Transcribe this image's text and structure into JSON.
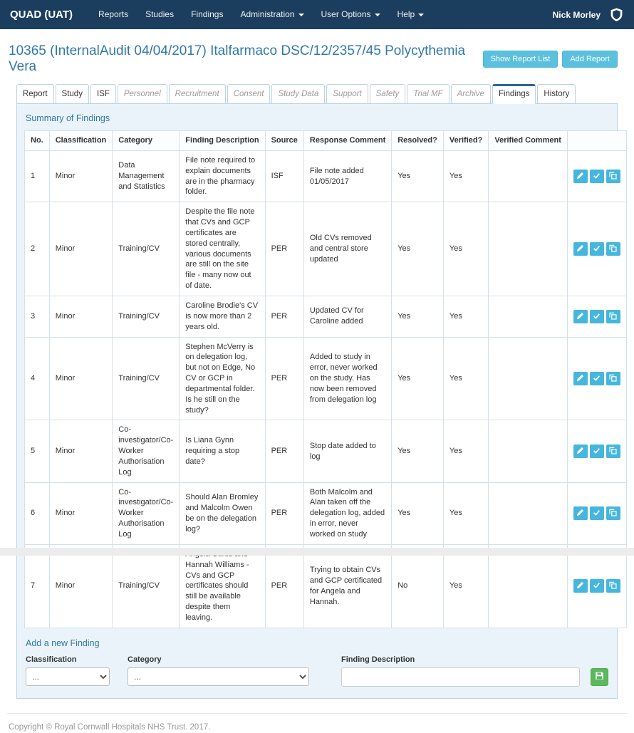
{
  "navbar": {
    "brand": "QUAD (UAT)",
    "items": [
      {
        "label": "Reports",
        "dropdown": false
      },
      {
        "label": "Studies",
        "dropdown": false
      },
      {
        "label": "Findings",
        "dropdown": false
      },
      {
        "label": "Administration",
        "dropdown": true
      },
      {
        "label": "User Options",
        "dropdown": true
      },
      {
        "label": "Help",
        "dropdown": true
      }
    ],
    "user": "Nick Morley",
    "logo_icon": "trust-logo-icon"
  },
  "header": {
    "title": "10365 (InternalAudit 04/04/2017) Italfarmaco DSC/12/2357/45 Polycythemia Vera",
    "show_report_list_label": "Show Report List",
    "add_report_label": "Add Report"
  },
  "tabs": [
    {
      "label": "Report",
      "state": "enabled"
    },
    {
      "label": "Study",
      "state": "enabled"
    },
    {
      "label": "ISF",
      "state": "enabled"
    },
    {
      "label": "Personnel",
      "state": "disabled"
    },
    {
      "label": "Recruitment",
      "state": "disabled"
    },
    {
      "label": "Consent",
      "state": "disabled"
    },
    {
      "label": "Study Data",
      "state": "disabled"
    },
    {
      "label": "Support",
      "state": "disabled"
    },
    {
      "label": "Safety",
      "state": "disabled"
    },
    {
      "label": "Trial MF",
      "state": "disabled"
    },
    {
      "label": "Archive",
      "state": "disabled"
    },
    {
      "label": "Findings",
      "state": "active"
    },
    {
      "label": "History",
      "state": "enabled"
    }
  ],
  "findings": {
    "section_title": "Summary of Findings",
    "columns": [
      "No.",
      "Classification",
      "Category",
      "Finding Description",
      "Source",
      "Response Comment",
      "Resolved?",
      "Verified?",
      "Verified Comment",
      ""
    ],
    "row_actions": [
      {
        "name": "edit",
        "icon": "pencil-icon"
      },
      {
        "name": "verify",
        "icon": "check-icon"
      },
      {
        "name": "copy",
        "icon": "copy-icon"
      }
    ],
    "rows": [
      {
        "no": "1",
        "classification": "Minor",
        "category": "Data Management and Statistics",
        "description": "File note required to explain documents are in the pharmacy folder.",
        "source": "ISF",
        "response": "File note added 01/05/2017",
        "resolved": "Yes",
        "verified": "Yes",
        "verified_comment": ""
      },
      {
        "no": "2",
        "classification": "Minor",
        "category": "Training/CV",
        "description": "Despite the file note that CVs and GCP certificates are stored centrally, various documents are still on the site file - many now out of date.",
        "source": "PER",
        "response": "Old CVs removed and central store updated",
        "resolved": "Yes",
        "verified": "Yes",
        "verified_comment": ""
      },
      {
        "no": "3",
        "classification": "Minor",
        "category": "Training/CV",
        "description": "Caroline Brodie's CV is now more than 2 years old.",
        "source": "PER",
        "response": "Updated CV for Caroline added",
        "resolved": "Yes",
        "verified": "Yes",
        "verified_comment": ""
      },
      {
        "no": "4",
        "classification": "Minor",
        "category": "Training/CV",
        "description": "Stephen McVerry is on delegation log, but not on Edge, No CV or GCP in departmental folder. Is he still on the study?",
        "source": "PER",
        "response": "Added to study in error, never worked on the study. Has now been removed from delegation log",
        "resolved": "Yes",
        "verified": "Yes",
        "verified_comment": ""
      },
      {
        "no": "5",
        "classification": "Minor",
        "category": "Co-investigator/Co-Worker Authorisation Log",
        "description": "Is Liana Gynn requiring a stop date?",
        "source": "PER",
        "response": "Stop date added to log",
        "resolved": "Yes",
        "verified": "Yes",
        "verified_comment": ""
      },
      {
        "no": "6",
        "classification": "Minor",
        "category": "Co-investigator/Co-Worker Authorisation Log",
        "description": "Should Alan Bromley and Malcolm Owen be on the delegation log?",
        "source": "PER",
        "response": "Both Malcolm and Alan taken off the delegation log, added in error, never worked on study",
        "resolved": "Yes",
        "verified": "Yes",
        "verified_comment": ""
      },
      {
        "no": "7",
        "classification": "Minor",
        "category": "Training/CV",
        "description": "Angela Curtis and Hannah Williams - CVs and GCP certificates should still be available despite them leaving.",
        "source": "PER",
        "response": "Trying to obtain CVs and GCP certificated for Angela and Hannah.",
        "resolved": "No",
        "verified": "Yes",
        "verified_comment": ""
      }
    ]
  },
  "add_finding": {
    "section_title": "Add a new Finding",
    "classification_label": "Classification",
    "classification_value": "...",
    "category_label": "Category",
    "category_value": "...",
    "description_label": "Finding Description",
    "save_icon": "save-icon"
  },
  "footer": {
    "copyright": "Copyright © Royal Cornwall Hospitals NHS Trust. 2017."
  },
  "colors": {
    "navbar_bg": "#1c3e5e",
    "accent_blue": "#2a6496",
    "heading_blue": "#3178a9",
    "info_button": "#5bc0de",
    "action_button": "#45b6dd",
    "success_button": "#5cb85c",
    "panel_bg": "#eaf3fa",
    "panel_border": "#bcd2e2"
  }
}
